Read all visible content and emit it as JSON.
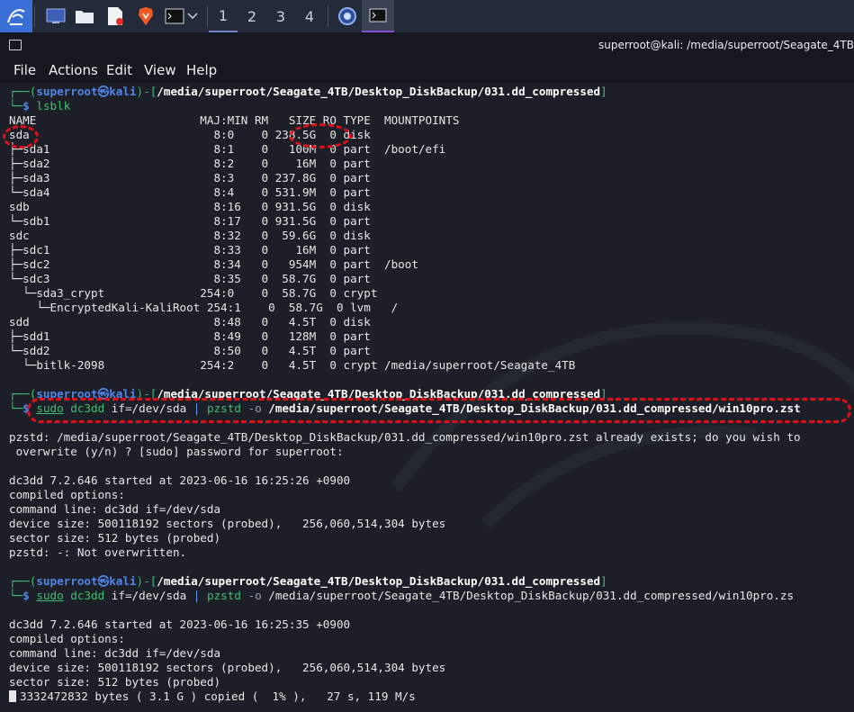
{
  "taskbar": {
    "workspaces": [
      "1",
      "2",
      "3",
      "4"
    ],
    "launchers": [
      "kali-menu-icon",
      "desktop-icon",
      "files-icon",
      "text-editor-icon",
      "brave-browser-icon",
      "terminal-icon"
    ],
    "running": [
      "kali-app-icon",
      "terminal-app-icon"
    ]
  },
  "window": {
    "title": "superroot@kali: /media/superroot/Seagate_4TB"
  },
  "menu": [
    "File",
    "Actions",
    "Edit",
    "View",
    "Help"
  ],
  "prompt": {
    "user": "superroot",
    "at": "㉿",
    "host": "kali",
    "path": "/media/superroot/Seagate_4TB/Desktop_DiskBackup/031.dd_compressed",
    "symbol": "$"
  },
  "commands": {
    "lsblk": "lsblk",
    "cmd2_sudo": "sudo",
    "cmd2_a": "dc3dd",
    "cmd2_b": " if=/dev/sda ",
    "cmd2_pipe": "|",
    "cmd2_c": "pzstd",
    "cmd2_d": "-o",
    "cmd2_out": "/media/superroot/Seagate_4TB/Desktop_DiskBackup/031.dd_compressed/win10pro.zst",
    "cmd3_out": "/media/superroot/Seagate_4TB/Desktop_DiskBackup/031.dd_compressed/win10pro.zs"
  },
  "lsblk": {
    "header": "NAME                        MAJ:MIN RM   SIZE RO TYPE  MOUNTPOINTS",
    "rows": [
      "sda                           8:0    0 238.5G  0 disk",
      "├─sda1                        8:1    0   100M  0 part  /boot/efi",
      "├─sda2                        8:2    0    16M  0 part",
      "├─sda3                        8:3    0 237.8G  0 part",
      "└─sda4                        8:4    0 531.9M  0 part",
      "sdb                           8:16   0 931.5G  0 disk",
      "└─sdb1                        8:17   0 931.5G  0 part",
      "sdc                           8:32   0  59.6G  0 disk",
      "├─sdc1                        8:33   0    16M  0 part",
      "├─sdc2                        8:34   0   954M  0 part  /boot",
      "└─sdc3                        8:35   0  58.7G  0 part",
      "  └─sda3_crypt              254:0    0  58.7G  0 crypt",
      "    └─EncryptedKali-KaliRoot 254:1    0  58.7G  0 lvm   /",
      "sdd                           8:48   0   4.5T  0 disk",
      "├─sdd1                        8:49   0   128M  0 part",
      "└─sdd2                        8:50   0   4.5T  0 part",
      "  └─bitlk-2098              254:2    0   4.5T  0 crypt /media/superroot/Seagate_4TB"
    ]
  },
  "output1": [
    "pzstd: /media/superroot/Seagate_4TB/Desktop_DiskBackup/031.dd_compressed/win10pro.zst already exists; do you wish to",
    " overwrite (y/n) ? [sudo] password for superroot:",
    "",
    "dc3dd 7.2.646 started at 2023-06-16 16:25:26 +0900",
    "compiled options:",
    "command line: dc3dd if=/dev/sda",
    "device size: 500118192 sectors (probed),   256,060,514,304 bytes",
    "sector size: 512 bytes (probed)",
    "pzstd: -: Not overwritten."
  ],
  "output2": [
    "dc3dd 7.2.646 started at 2023-06-16 16:25:35 +0900",
    "compiled options:",
    "command line: dc3dd if=/dev/sda",
    "device size: 500118192 sectors (probed),   256,060,514,304 bytes",
    "sector size: 512 bytes (probed)"
  ],
  "progress": "3332472832 bytes ( 3.1 G ) copied (  1% ),   27 s, 119 M/s",
  "colors": {
    "prompt_frame": "#3fbf70",
    "prompt_user": "#4f86e8",
    "annotation": "#e0101a",
    "terminal_bg": "#1c1f27",
    "taskbar_bg": "#232a3a"
  }
}
